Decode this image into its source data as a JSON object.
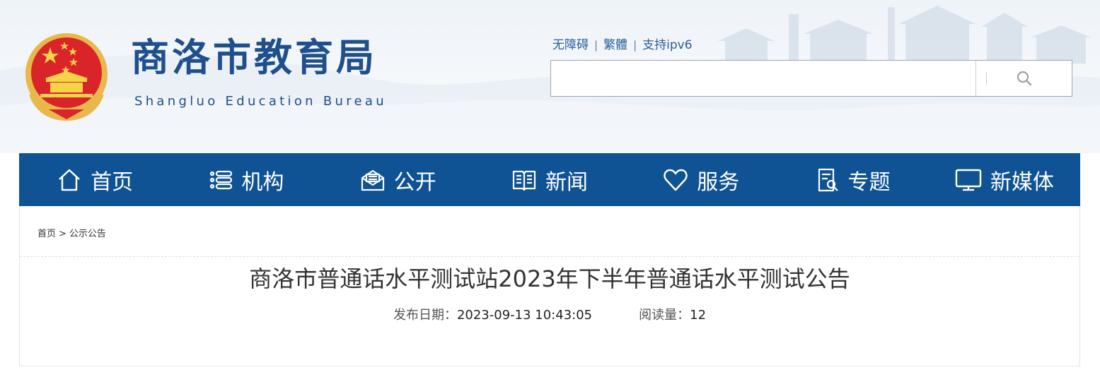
{
  "header": {
    "title": "商洛市教育局",
    "subtitle": "Shangluo Education Bureau",
    "top_links": [
      "无障碍",
      "繁體",
      "支持ipv6"
    ],
    "top_link_separator": "|",
    "search": {
      "placeholder": "",
      "button_icon": "search-icon"
    }
  },
  "nav": {
    "items": [
      {
        "label": "首页",
        "icon": "home-icon"
      },
      {
        "label": "机构",
        "icon": "list-icon"
      },
      {
        "label": "公开",
        "icon": "mail-open-icon"
      },
      {
        "label": "新闻",
        "icon": "book-icon"
      },
      {
        "label": "服务",
        "icon": "heart-icon"
      },
      {
        "label": "专题",
        "icon": "document-icon"
      },
      {
        "label": "新媒体",
        "icon": "monitor-icon"
      }
    ]
  },
  "breadcrumb": {
    "home": "首页",
    "separator": ">",
    "current": "公示公告"
  },
  "article": {
    "title": "商洛市普通话水平测试站2023年下半年普通话水平测试公告",
    "publish_label": "发布日期：",
    "publish_date": "2023-09-13 10:43:05",
    "views_label": "阅读量：",
    "views": "12"
  },
  "colors": {
    "nav_background": "#0f5394",
    "title_blue": "#1f4f8c",
    "link_blue": "#2a5e9b"
  }
}
